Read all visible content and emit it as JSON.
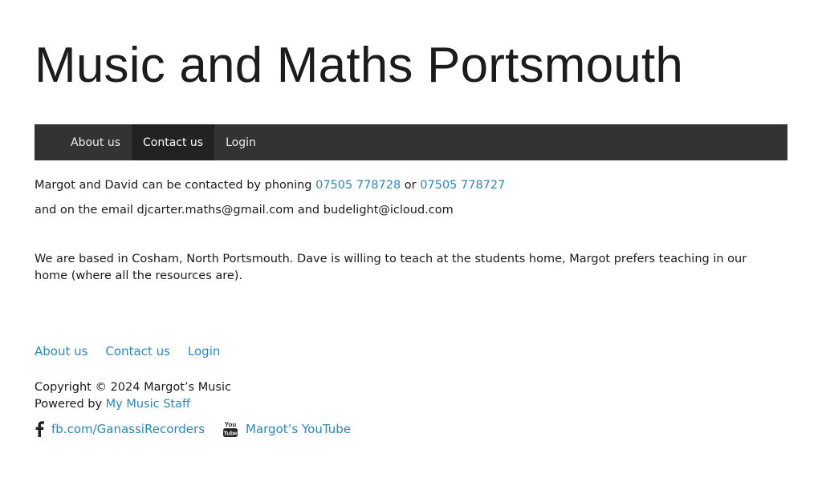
{
  "site": {
    "title": "Music and Maths Portsmouth"
  },
  "nav": {
    "items": [
      {
        "label": "About us",
        "active": false
      },
      {
        "label": "Contact us",
        "active": true
      },
      {
        "label": "Login",
        "active": false
      }
    ]
  },
  "content": {
    "line1_prefix": "Margot and David can be contacted by phoning ",
    "phone1": "07505 778728",
    "line1_or": " or ",
    "phone2": "07505 778727",
    "line2": "and on the email djcarter.maths@gmail.com and budelight@icloud.com",
    "para2": "We are based in Cosham, North Portsmouth.  Dave is willing to teach at the students home, Margot prefers teaching in our home (where all the resources are)."
  },
  "footer": {
    "links": [
      "About us",
      "Contact us",
      "Login"
    ],
    "copyright": "Copyright © 2024 Margot’s Music",
    "powered_prefix": "Powered by ",
    "powered_link": "My Music Staff",
    "facebook_label": "fb.com/GanassiRecorders",
    "youtube_label": "Margot’s YouTube",
    "youtube_icon_text": [
      "You",
      "Tube"
    ]
  },
  "colors": {
    "link": "#2e86b3",
    "nav_bg": "#333333",
    "nav_active_bg": "#222222"
  },
  "icons": {
    "facebook": "facebook-icon",
    "youtube": "youtube-icon"
  }
}
